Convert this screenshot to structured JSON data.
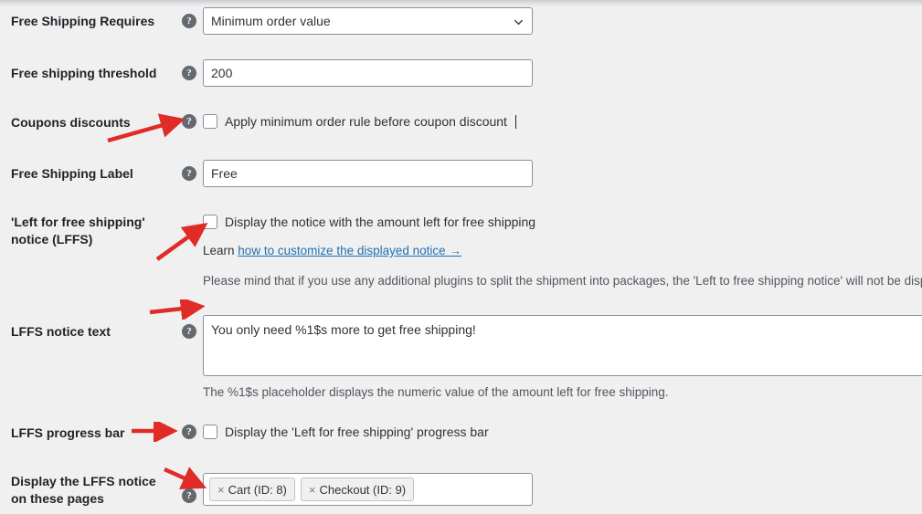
{
  "theme": {
    "page_background": "#f0f0f1",
    "input_background": "#ffffff",
    "border_color": "#8c8f94",
    "link_color": "#2271b1",
    "help_icon_color": "#646970",
    "annotation_color": "#e02b27",
    "text_color": "#1d2327",
    "muted_text_color": "#50575e"
  },
  "rows": {
    "free_shipping_requires": {
      "label": "Free Shipping Requires",
      "help_icon": "help-icon",
      "select_value": "Minimum order value",
      "options": [
        "Minimum order value"
      ],
      "dropdown_icon": "chevron-down-icon"
    },
    "free_shipping_threshold": {
      "label": "Free shipping threshold",
      "help_icon": "help-icon",
      "value": "200"
    },
    "coupons_discounts": {
      "label": "Coupons discounts",
      "help_icon": "help-icon",
      "checkbox_label": "Apply minimum order rule before coupon discount",
      "checked": false
    },
    "free_shipping_label": {
      "label": "Free Shipping Label",
      "help_icon": "help-icon",
      "value": "Free"
    },
    "lffs_notice": {
      "label": "'Left for free shipping' notice (LFFS)",
      "checkbox_label": "Display the notice with the amount left for free shipping",
      "checked": false,
      "learn_prefix": "Learn",
      "learn_link": "how to customize the displayed notice →",
      "description": "Please mind that if you use any additional plugins to split the shipment into packages, the 'Left to free shipping notice' will not be displayed."
    },
    "lffs_notice_text": {
      "label": "LFFS notice text",
      "help_icon": "help-icon",
      "value": "You only need %1$s more to get free shipping!",
      "description": "The %1$s placeholder displays the numeric value of the amount left for free shipping."
    },
    "lffs_progress_bar": {
      "label": "LFFS progress bar",
      "help_icon": "help-icon",
      "checkbox_label": "Display the 'Left for free shipping' progress bar",
      "checked": false
    },
    "lffs_pages": {
      "label": "Display the LFFS notice on these pages",
      "help_icon": "help-icon",
      "tokens": [
        {
          "remove_icon": "×",
          "text": "Cart (ID: 8)"
        },
        {
          "remove_icon": "×",
          "text": "Checkout (ID: 9)"
        }
      ]
    }
  },
  "annotations": {
    "arrow_count": 5,
    "color": "#e02b27"
  }
}
